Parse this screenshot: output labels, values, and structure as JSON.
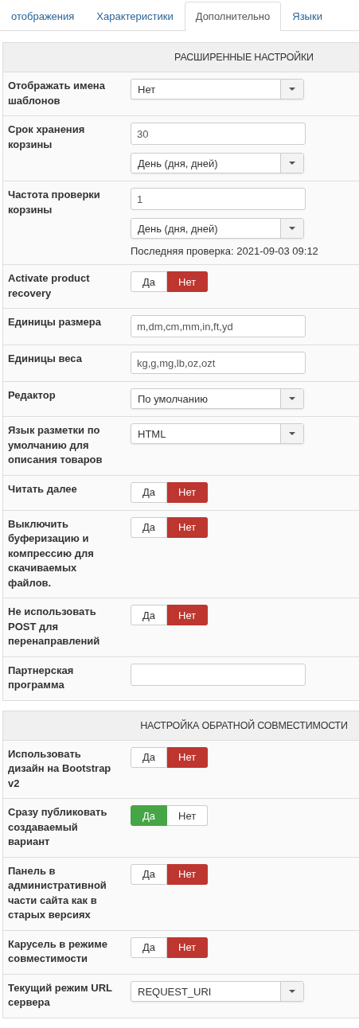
{
  "tabs": [
    {
      "label": "отображения",
      "selected": false
    },
    {
      "label": "Характеристики",
      "selected": false
    },
    {
      "label": "Дополнительно",
      "selected": true
    },
    {
      "label": "Языки",
      "selected": false
    }
  ],
  "sections": [
    {
      "title": "РАСШИРЕННЫЕ НАСТРОЙКИ",
      "rows": [
        {
          "label": "Отображать имена шаблонов",
          "controls": [
            {
              "kind": "select",
              "value": "Нет"
            }
          ]
        },
        {
          "label": "Срок хранения корзины",
          "controls": [
            {
              "kind": "input",
              "value": "30"
            },
            {
              "kind": "select",
              "value": "День (дня, дней)"
            }
          ]
        },
        {
          "label": "Частота проверки корзины",
          "controls": [
            {
              "kind": "input",
              "value": "1"
            },
            {
              "kind": "select",
              "value": "День (дня, дней)"
            },
            {
              "kind": "note",
              "text": "Последняя проверка: 2021-09-03 09:12"
            }
          ]
        },
        {
          "label": "Activate product recovery",
          "controls": [
            {
              "kind": "toggle",
              "options": [
                {
                  "label": "Да",
                  "kind": "yes",
                  "selected": false
                },
                {
                  "label": "Нет",
                  "kind": "no",
                  "selected": true
                }
              ]
            }
          ]
        },
        {
          "label": "Единицы размера",
          "controls": [
            {
              "kind": "input",
              "value": "m,dm,cm,mm,in,ft,yd"
            }
          ]
        },
        {
          "label": "Единицы веса",
          "controls": [
            {
              "kind": "input",
              "value": "kg,g,mg,lb,oz,ozt"
            }
          ]
        },
        {
          "label": "Редактор",
          "controls": [
            {
              "kind": "select",
              "value": "По умолчанию"
            }
          ]
        },
        {
          "label": "Язык разметки по умолчанию для описания товаров",
          "controls": [
            {
              "kind": "select",
              "value": "HTML"
            }
          ]
        },
        {
          "label": "Читать далее",
          "controls": [
            {
              "kind": "toggle",
              "options": [
                {
                  "label": "Да",
                  "kind": "yes",
                  "selected": false
                },
                {
                  "label": "Нет",
                  "kind": "no",
                  "selected": true
                }
              ]
            }
          ]
        },
        {
          "label": "Выключить буферизацию и компрессию для скачиваемых файлов.",
          "controls": [
            {
              "kind": "toggle",
              "options": [
                {
                  "label": "Да",
                  "kind": "yes",
                  "selected": false
                },
                {
                  "label": "Нет",
                  "kind": "no",
                  "selected": true
                }
              ]
            }
          ]
        },
        {
          "label": "Не использовать POST для перенаправлений",
          "controls": [
            {
              "kind": "toggle",
              "options": [
                {
                  "label": "Да",
                  "kind": "yes",
                  "selected": false
                },
                {
                  "label": "Нет",
                  "kind": "no",
                  "selected": true
                }
              ]
            }
          ]
        },
        {
          "label": "Партнерская программа",
          "controls": [
            {
              "kind": "input"
            }
          ]
        }
      ]
    },
    {
      "title": "НАСТРОЙКА ОБРАТНОЙ СОВМЕСТИМОСТИ",
      "rows": [
        {
          "label": "Использовать дизайн на Bootstrap v2",
          "controls": [
            {
              "kind": "toggle",
              "options": [
                {
                  "label": "Да",
                  "kind": "yes",
                  "selected": false
                },
                {
                  "label": "Нет",
                  "kind": "no",
                  "selected": true
                }
              ]
            }
          ]
        },
        {
          "label": "Сразу публиковать создаваемый вариант",
          "controls": [
            {
              "kind": "toggle",
              "options": [
                {
                  "label": "Да",
                  "kind": "yes",
                  "selected": true
                },
                {
                  "label": "Нет",
                  "kind": "no",
                  "selected": false
                }
              ]
            }
          ]
        },
        {
          "label": "Панель в административной части сайта как в старых версиях",
          "controls": [
            {
              "kind": "toggle",
              "options": [
                {
                  "label": "Да",
                  "kind": "yes",
                  "selected": false
                },
                {
                  "label": "Нет",
                  "kind": "no",
                  "selected": true
                }
              ]
            }
          ]
        },
        {
          "label": "Карусель в режиме совместимости",
          "controls": [
            {
              "kind": "toggle",
              "options": [
                {
                  "label": "Да",
                  "kind": "yes",
                  "selected": false
                },
                {
                  "label": "Нет",
                  "kind": "no",
                  "selected": true
                }
              ]
            }
          ]
        },
        {
          "label": "Текущий режим URL сервера",
          "controls": [
            {
              "kind": "select",
              "value": "REQUEST_URI"
            }
          ]
        }
      ]
    }
  ]
}
